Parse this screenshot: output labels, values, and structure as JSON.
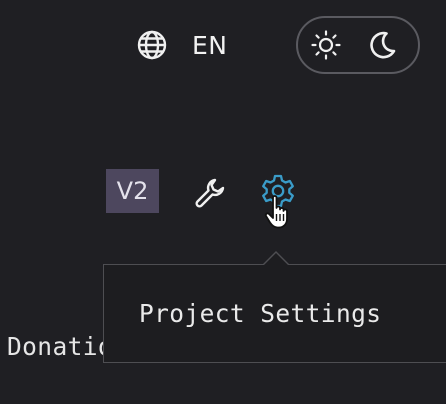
{
  "language": {
    "code": "EN",
    "icon": "globe-icon"
  },
  "theme_toggle": {
    "light_icon": "sun-icon",
    "dark_icon": "moon-icon"
  },
  "toolbar": {
    "version_badge": "V2",
    "wrench_icon": "wrench-icon",
    "settings_icon": "gear-icon",
    "settings_icon_color": "#3a9cc9"
  },
  "tooltip": {
    "text": "Project Settings"
  },
  "footer": {
    "donation_link": "Donations"
  }
}
